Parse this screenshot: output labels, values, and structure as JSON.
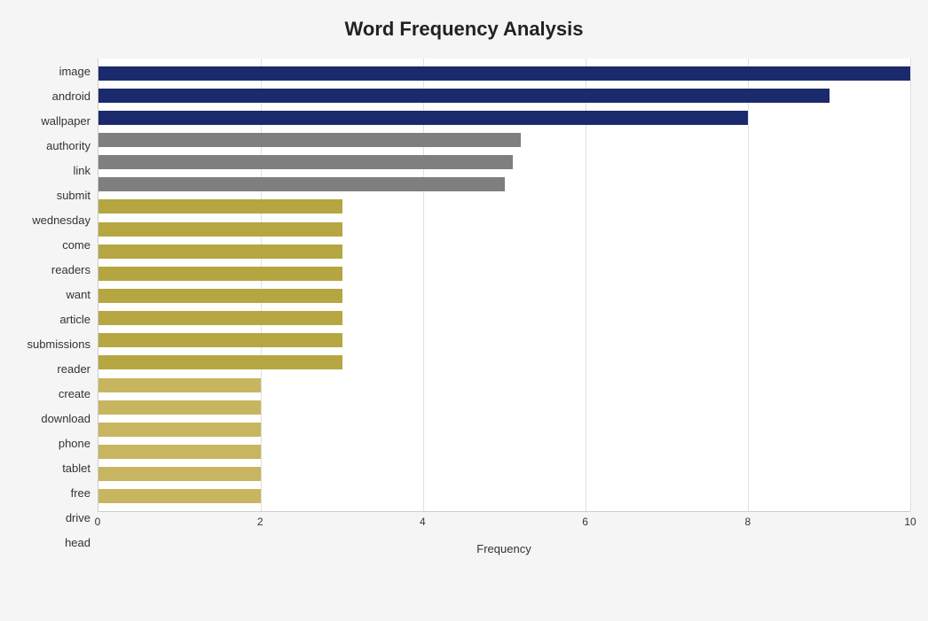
{
  "title": "Word Frequency Analysis",
  "x_axis_label": "Frequency",
  "max_value": 10,
  "x_ticks": [
    0,
    2,
    4,
    6,
    8,
    10
  ],
  "bars": [
    {
      "label": "image",
      "value": 10,
      "color": "#1a2a6c"
    },
    {
      "label": "android",
      "value": 9,
      "color": "#1a2a6c"
    },
    {
      "label": "wallpaper",
      "value": 8,
      "color": "#1a2a6c"
    },
    {
      "label": "authority",
      "value": 5.2,
      "color": "#7f7f7f"
    },
    {
      "label": "link",
      "value": 5.1,
      "color": "#7f7f7f"
    },
    {
      "label": "submit",
      "value": 5.0,
      "color": "#7f7f7f"
    },
    {
      "label": "wednesday",
      "value": 3,
      "color": "#b5a642"
    },
    {
      "label": "come",
      "value": 3,
      "color": "#b5a642"
    },
    {
      "label": "readers",
      "value": 3,
      "color": "#b5a642"
    },
    {
      "label": "want",
      "value": 3,
      "color": "#b5a642"
    },
    {
      "label": "article",
      "value": 3,
      "color": "#b5a642"
    },
    {
      "label": "submissions",
      "value": 3,
      "color": "#b5a642"
    },
    {
      "label": "reader",
      "value": 3,
      "color": "#b5a642"
    },
    {
      "label": "create",
      "value": 3,
      "color": "#b5a642"
    },
    {
      "label": "download",
      "value": 2,
      "color": "#c8b560"
    },
    {
      "label": "phone",
      "value": 2,
      "color": "#c8b560"
    },
    {
      "label": "tablet",
      "value": 2,
      "color": "#c8b560"
    },
    {
      "label": "free",
      "value": 2,
      "color": "#c8b560"
    },
    {
      "label": "drive",
      "value": 2,
      "color": "#c8b560"
    },
    {
      "label": "head",
      "value": 2,
      "color": "#c8b560"
    }
  ]
}
